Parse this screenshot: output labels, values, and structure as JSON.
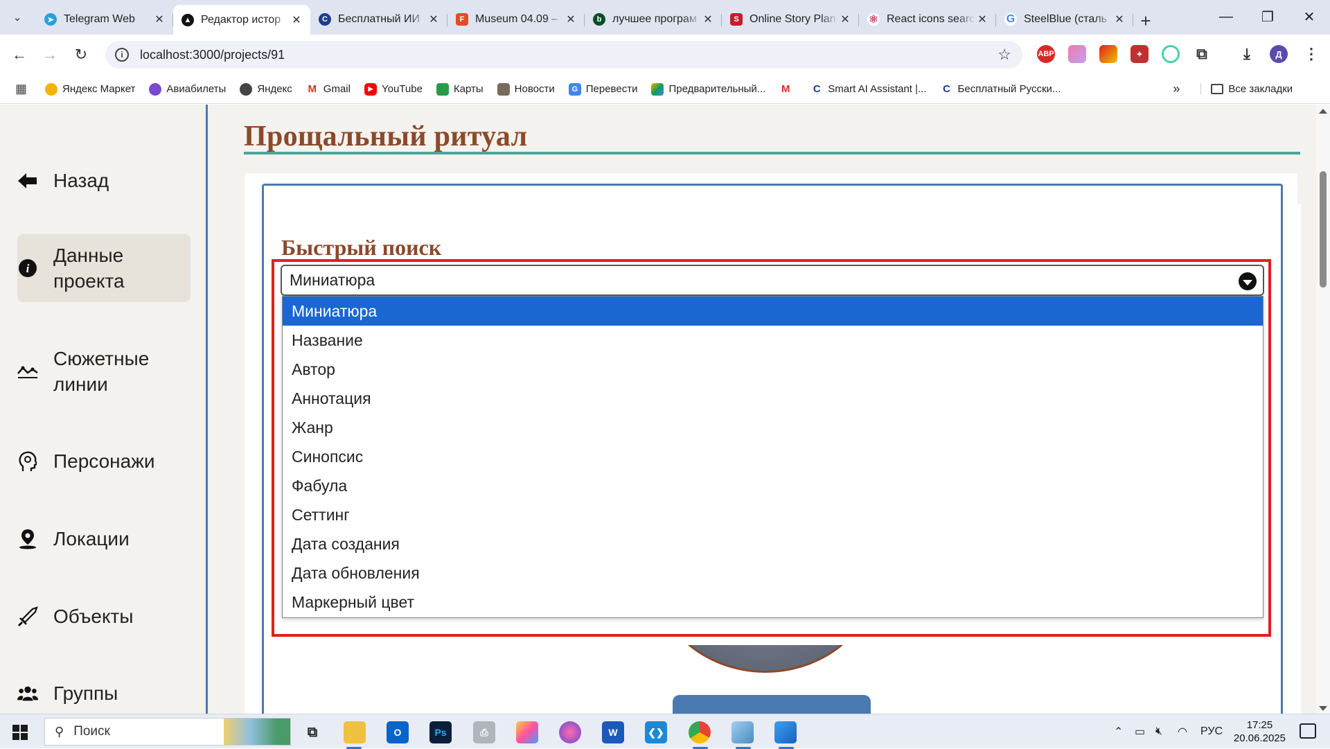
{
  "browser": {
    "tabs": [
      {
        "title": "Telegram Web",
        "icon": "telegram-icon",
        "color": "#2aa0da",
        "active": false
      },
      {
        "title": "Редактор истор",
        "icon": "app-triangle-icon",
        "color": "#111111",
        "active": true
      },
      {
        "title": "Бесплатный ИИ",
        "icon": "c-icon",
        "color": "#1c3d8c",
        "active": false
      },
      {
        "title": "Museum 04.09 –",
        "icon": "figma-icon",
        "color": "#e24a2c",
        "active": false
      },
      {
        "title": "лучшее програм",
        "icon": "b-icon",
        "color": "#0b4d2a",
        "active": false
      },
      {
        "title": "Online Story Plan",
        "icon": "story-icon",
        "color": "#c0202a",
        "active": false
      },
      {
        "title": "React icons searc",
        "icon": "react-icon",
        "color": "#d04a7a",
        "active": false
      },
      {
        "title": "SteelBlue (сталь",
        "icon": "google-icon",
        "color": "#4285f4",
        "active": false
      }
    ],
    "url": "localhost:3000/projects/91",
    "bookmarks": [
      {
        "label": "Яндекс Маркет",
        "color": "#f2b400"
      },
      {
        "label": "Авиабилеты",
        "color": "#7a4ad0"
      },
      {
        "label": "Яндекс",
        "color": "#444444"
      },
      {
        "label": "Gmail",
        "color": "#d93025"
      },
      {
        "label": "YouTube",
        "color": "#ff0000"
      },
      {
        "label": "Карты",
        "color": "#2a9a4a"
      },
      {
        "label": "Новости",
        "color": "#7a6a5a"
      },
      {
        "label": "Перевести",
        "color": "#4285f4"
      },
      {
        "label": "Предварительный...",
        "color": "#f4b400"
      },
      {
        "label": "",
        "color": "#d93025"
      },
      {
        "label": "Smart AI Assistant |...",
        "color": "#1c3d8c"
      },
      {
        "label": "Бесплатный Русски...",
        "color": "#1c3d8c"
      }
    ],
    "all_bookmarks": "Все закладки"
  },
  "sidebar": {
    "items": [
      {
        "label": "Назад",
        "icon": "arrow-left-icon",
        "active": false
      },
      {
        "label": "Данные проекта",
        "icon": "info-icon",
        "active": true
      },
      {
        "label": "Сюжетные линии",
        "icon": "plotline-icon",
        "active": false
      },
      {
        "label": "Персонажи",
        "icon": "person-head-icon",
        "active": false
      },
      {
        "label": "Локации",
        "icon": "location-pin-icon",
        "active": false
      },
      {
        "label": "Объекты",
        "icon": "sword-icon",
        "active": false
      },
      {
        "label": "Группы",
        "icon": "users-icon",
        "active": false
      }
    ]
  },
  "main": {
    "title": "Прощальный ритуал",
    "quick_search_label": "Быстрый поиск",
    "select_value": "Миниатюра",
    "options": [
      "Миниатюра",
      "Название",
      "Автор",
      "Аннотация",
      "Жанр",
      "Синопсис",
      "Фабула",
      "Сеттинг",
      "Дата создания",
      "Дата обновления",
      "Маркерный цвет"
    ],
    "selected_index": 0
  },
  "taskbar": {
    "search_placeholder": "Поиск",
    "language": "РУС",
    "time": "17:25",
    "date": "20.06.2025",
    "apps": [
      "task-view-icon",
      "file-explorer-icon",
      "outlook-icon",
      "photoshop-icon",
      "printer-app-icon",
      "app-fan-icon",
      "app-ball-icon",
      "word-icon",
      "vscode-icon",
      "chrome-icon",
      "app-blue-icon",
      "photos-icon"
    ]
  },
  "colors": {
    "accent": "#4a7ab0",
    "title_brown": "#8a4a2b",
    "selected_option": "#1a67d1",
    "highlight_frame": "#e02020"
  }
}
